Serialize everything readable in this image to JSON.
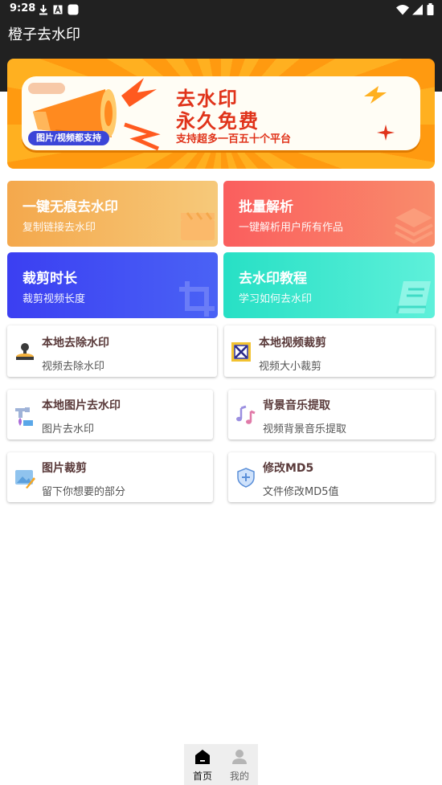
{
  "status_bar": {
    "time": "9:28"
  },
  "app": {
    "title": "橙子去水印"
  },
  "banner": {
    "headline_1": "去水印",
    "headline_2": "永久免费",
    "tagline": "支持超多一百五十个平台",
    "pill": "图片/视频都支持"
  },
  "feature_cards": [
    {
      "title": "一键无痕去水印",
      "subtitle": "复制链接去水印",
      "icon": "clapperboard-icon"
    },
    {
      "title": "批量解析",
      "subtitle": "一键解析用户所有作品",
      "icon": "layers-icon"
    },
    {
      "title": "裁剪时长",
      "subtitle": "裁剪视频长度",
      "icon": "crop-icon"
    },
    {
      "title": "去水印教程",
      "subtitle": "学习如何去水印",
      "icon": "book-icon"
    }
  ],
  "tools": [
    {
      "title": "本地去除水印",
      "subtitle": "视频去除水印",
      "icon": "stamp-icon"
    },
    {
      "title": "本地视频裁剪",
      "subtitle": "视频大小裁剪",
      "icon": "crop-frame-icon"
    },
    {
      "title": "本地图片去水印",
      "subtitle": "图片去水印",
      "icon": "faucet-icon"
    },
    {
      "title": "背景音乐提取",
      "subtitle": "视频背景音乐提取",
      "icon": "music-notes-icon"
    },
    {
      "title": "图片裁剪",
      "subtitle": "留下你想要的部分",
      "icon": "image-edit-icon"
    },
    {
      "title": "修改MD5",
      "subtitle": "文件修改MD5值",
      "icon": "shield-icon"
    }
  ],
  "bottom_nav": [
    {
      "label": "首页",
      "icon": "home-icon",
      "active": true
    },
    {
      "label": "我的",
      "icon": "user-icon",
      "active": false
    }
  ],
  "colors": {
    "card_orange": "#f4a84c",
    "card_red": "#fa5e5e",
    "card_blue": "#3b3ff2",
    "card_teal": "#27e0c5",
    "banner_red": "#e0331a",
    "banner_orange": "#ffb020"
  }
}
